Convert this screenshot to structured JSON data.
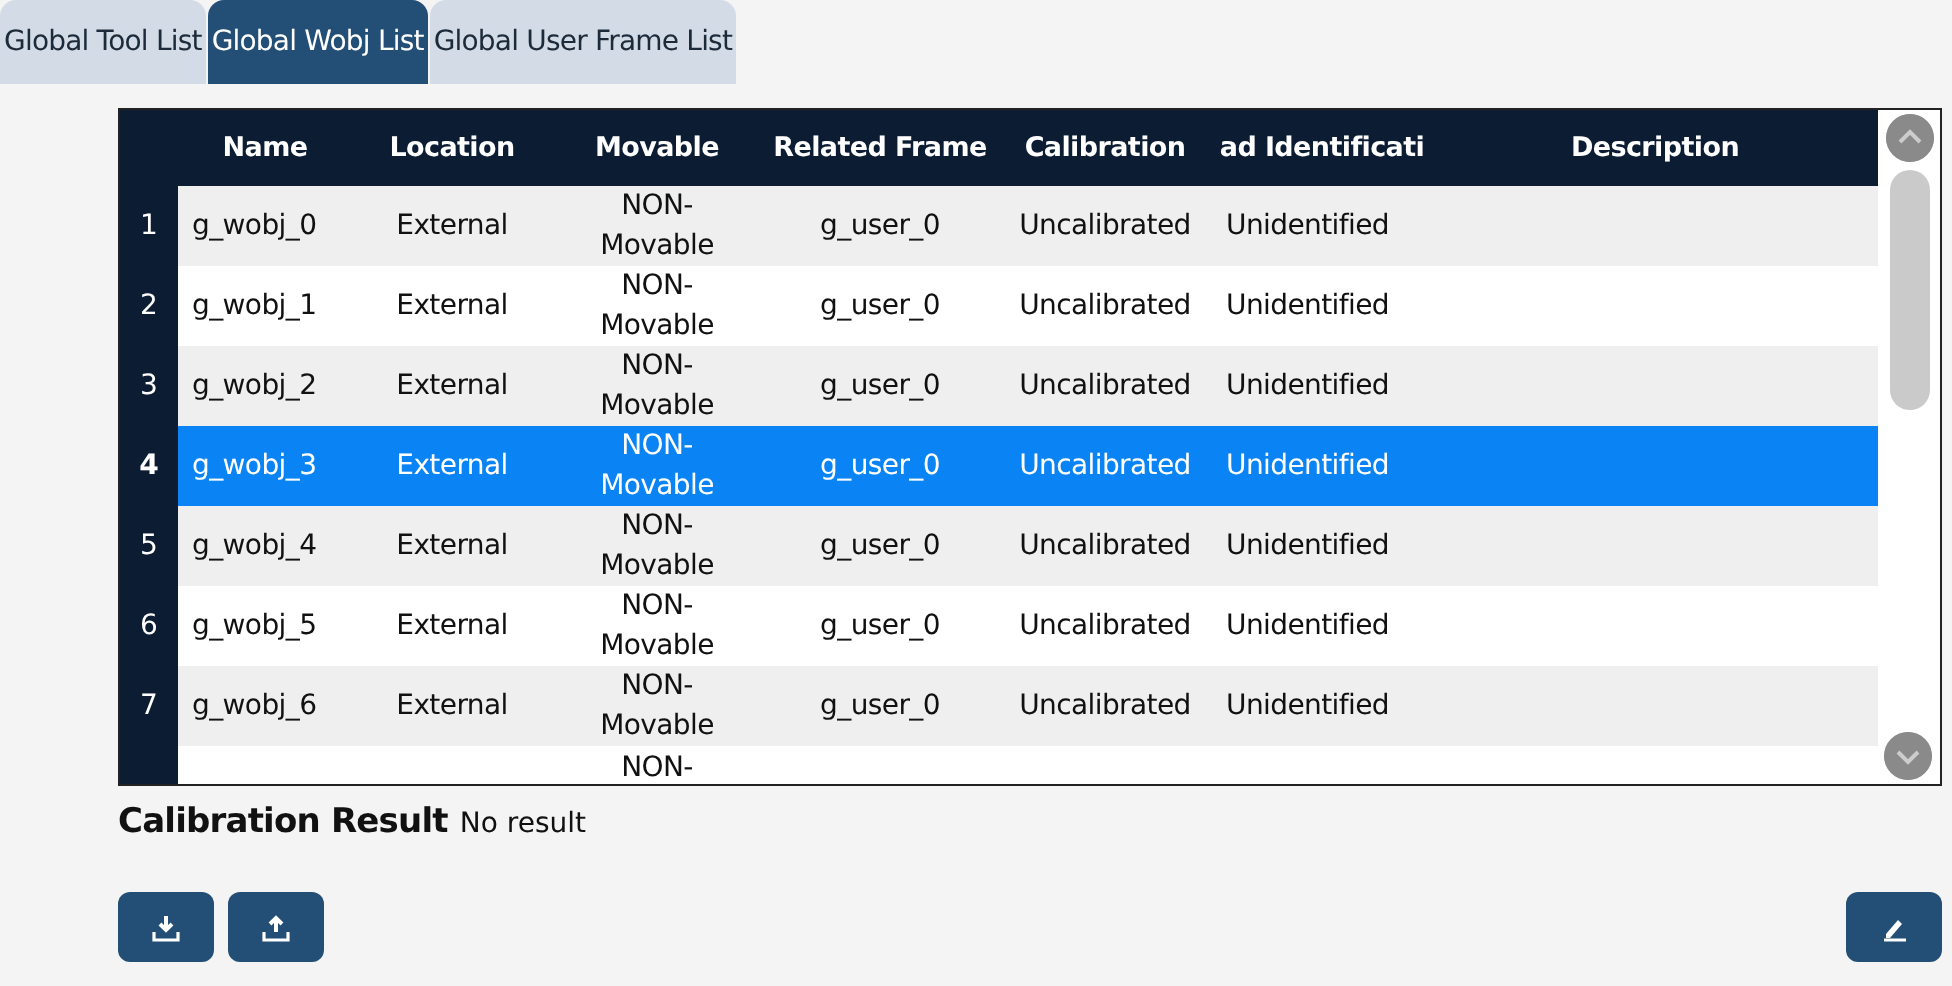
{
  "tabs": [
    {
      "label": "Global Tool List",
      "selected": false
    },
    {
      "label": "Global Wobj List",
      "selected": true
    },
    {
      "label": "Global User Frame List",
      "selected": false
    }
  ],
  "table": {
    "columns": [
      "Name",
      "Location",
      "Movable",
      "Related Frame",
      "Calibration",
      "ad Identificati",
      "Description"
    ],
    "rows": [
      {
        "index": "1",
        "name": "g_wobj_0",
        "location": "External",
        "movable": "NON-\nMovable",
        "related_frame": "g_user_0",
        "calibration": "Uncalibrated",
        "load_identification": "Unidentified",
        "selected": false
      },
      {
        "index": "2",
        "name": "g_wobj_1",
        "location": "External",
        "movable": "NON-\nMovable",
        "related_frame": "g_user_0",
        "calibration": "Uncalibrated",
        "load_identification": "Unidentified",
        "selected": false
      },
      {
        "index": "3",
        "name": "g_wobj_2",
        "location": "External",
        "movable": "NON-\nMovable",
        "related_frame": "g_user_0",
        "calibration": "Uncalibrated",
        "load_identification": "Unidentified",
        "selected": false
      },
      {
        "index": "4",
        "name": "g_wobj_3",
        "location": "External",
        "movable": "NON-\nMovable",
        "related_frame": "g_user_0",
        "calibration": "Uncalibrated",
        "load_identification": "Unidentified",
        "selected": true
      },
      {
        "index": "5",
        "name": "g_wobj_4",
        "location": "External",
        "movable": "NON-\nMovable",
        "related_frame": "g_user_0",
        "calibration": "Uncalibrated",
        "load_identification": "Unidentified",
        "selected": false
      },
      {
        "index": "6",
        "name": "g_wobj_5",
        "location": "External",
        "movable": "NON-\nMovable",
        "related_frame": "g_user_0",
        "calibration": "Uncalibrated",
        "load_identification": "Unidentified",
        "selected": false
      },
      {
        "index": "7",
        "name": "g_wobj_6",
        "location": "External",
        "movable": "NON-\nMovable",
        "related_frame": "g_user_0",
        "calibration": "Uncalibrated",
        "load_identification": "Unidentified",
        "selected": false
      },
      {
        "movable": "NON-",
        "selected": false
      }
    ]
  },
  "calibration_result": {
    "label": "Calibration Result",
    "value": "No result"
  }
}
